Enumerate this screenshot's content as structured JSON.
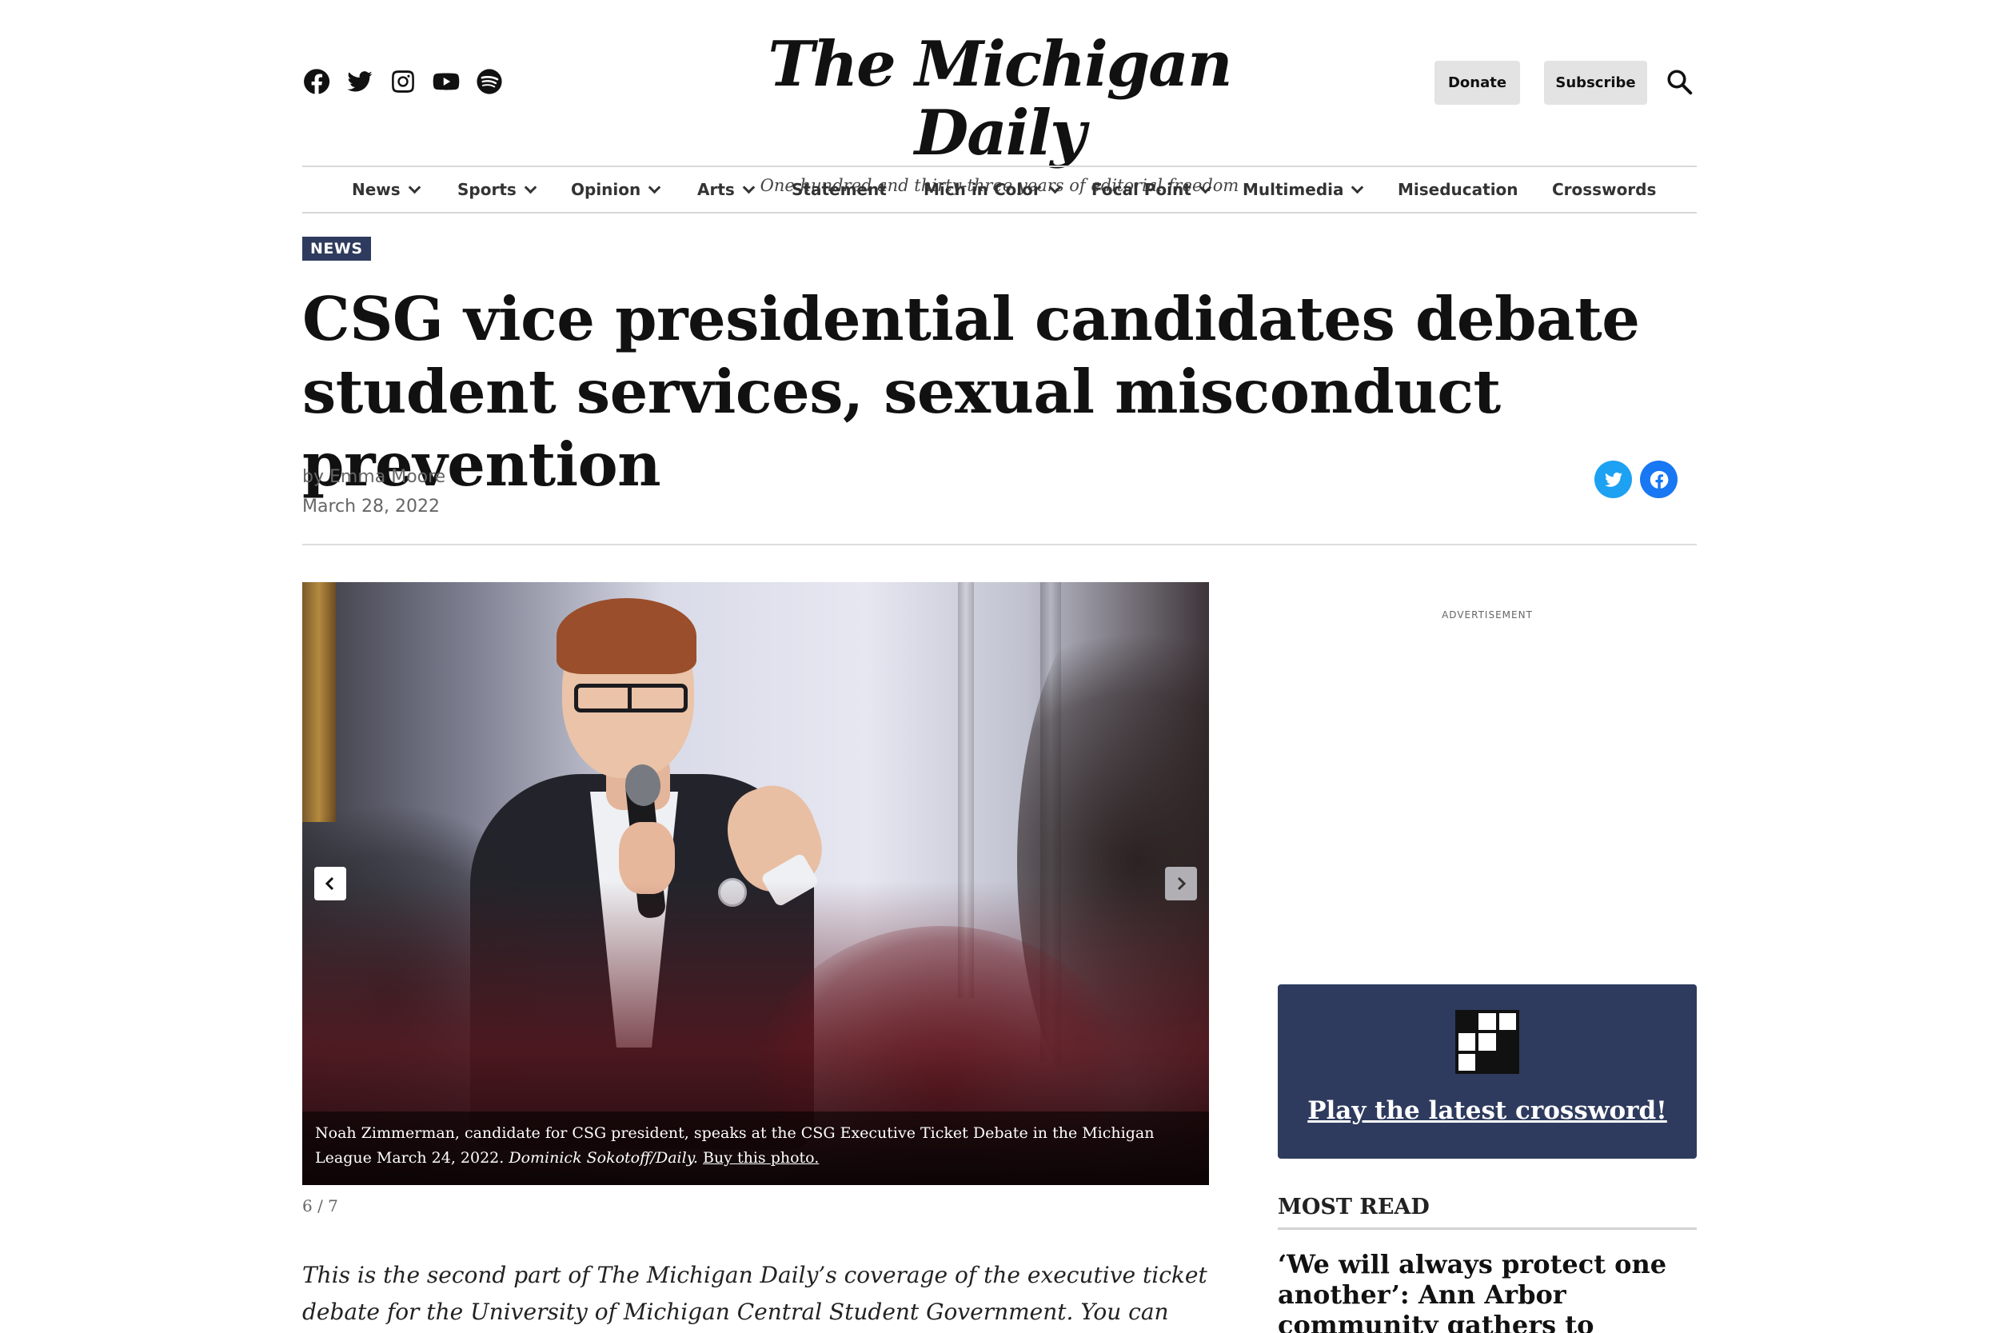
{
  "header": {
    "social": [
      "facebook-icon",
      "twitter-icon",
      "instagram-icon",
      "youtube-icon",
      "spotify-icon"
    ],
    "logo": "The Michigan Daily",
    "tagline": "One hundred and thirty-three years of editorial freedom",
    "donate_label": "Donate",
    "subscribe_label": "Subscribe"
  },
  "nav": {
    "items": [
      {
        "label": "News",
        "dropdown": true
      },
      {
        "label": "Sports",
        "dropdown": true
      },
      {
        "label": "Opinion",
        "dropdown": true
      },
      {
        "label": "Arts",
        "dropdown": true
      },
      {
        "label": "Statement",
        "dropdown": false
      },
      {
        "label": "Mich in Color",
        "dropdown": true
      },
      {
        "label": "Focal Point",
        "dropdown": true
      },
      {
        "label": "Multimedia",
        "dropdown": true
      },
      {
        "label": "Miseducation",
        "dropdown": false
      },
      {
        "label": "Crosswords",
        "dropdown": false
      }
    ]
  },
  "article": {
    "kicker": "NEWS",
    "headline": "CSG vice presidential candidates debate student services, sexual misconduct prevention",
    "byline": "by Emma Moore",
    "date": "March 28, 2022",
    "photo": {
      "caption_text": "Noah Zimmerman, candidate for CSG president, speaks at the CSG Executive Ticket Debate in the Michigan League March 24, 2022. ",
      "credit": "Dominick Sokotoff/Daily.",
      "buy_link": "Buy this photo.",
      "counter": "6 / 7"
    },
    "lede": "This is the second part of The Michigan Daily’s coverage of the executive ticket debate for the University of Michigan Central Student Government. You can find our"
  },
  "sidebar": {
    "ad_label": "ADVERTISEMENT",
    "crossword_cta": "Play the latest crossword!",
    "most_read_title": "MOST READ",
    "most_read_first": "‘We will always protect one another’: Ann Arbor community gathers to protest UMich"
  },
  "colors": {
    "navy": "#2e3b5e",
    "twitter": "#1da1f2",
    "facebook": "#1877f2"
  }
}
